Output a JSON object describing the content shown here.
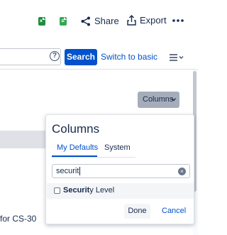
{
  "toolbar": {
    "share_label": "Share",
    "export_label": "Export",
    "excel_icon": "excel-icon",
    "sheets_icon": "google-sheets-icon",
    "more_icon": "more-horizontal-icon"
  },
  "search": {
    "help_icon_text": "?",
    "search_button_label": "Search",
    "switch_link_label": "Switch to basic"
  },
  "columns_button": {
    "label": "Columns"
  },
  "background": {
    "row_text": "for CS-30"
  },
  "popover": {
    "title": "Columns",
    "tabs": [
      {
        "label": "My Defaults",
        "active": true
      },
      {
        "label": "System",
        "active": false
      }
    ],
    "filter_value": "securit",
    "clear_icon_text": "×",
    "options": [
      {
        "match": "Securit",
        "rest": "y Level",
        "checked": false
      }
    ],
    "done_label": "Done",
    "cancel_label": "Cancel"
  },
  "colors": {
    "primary": "#0052cc",
    "excel_green": "#1e8e3e",
    "sheets_green": "#34a853",
    "columns_button_bg": "#a5adba"
  }
}
